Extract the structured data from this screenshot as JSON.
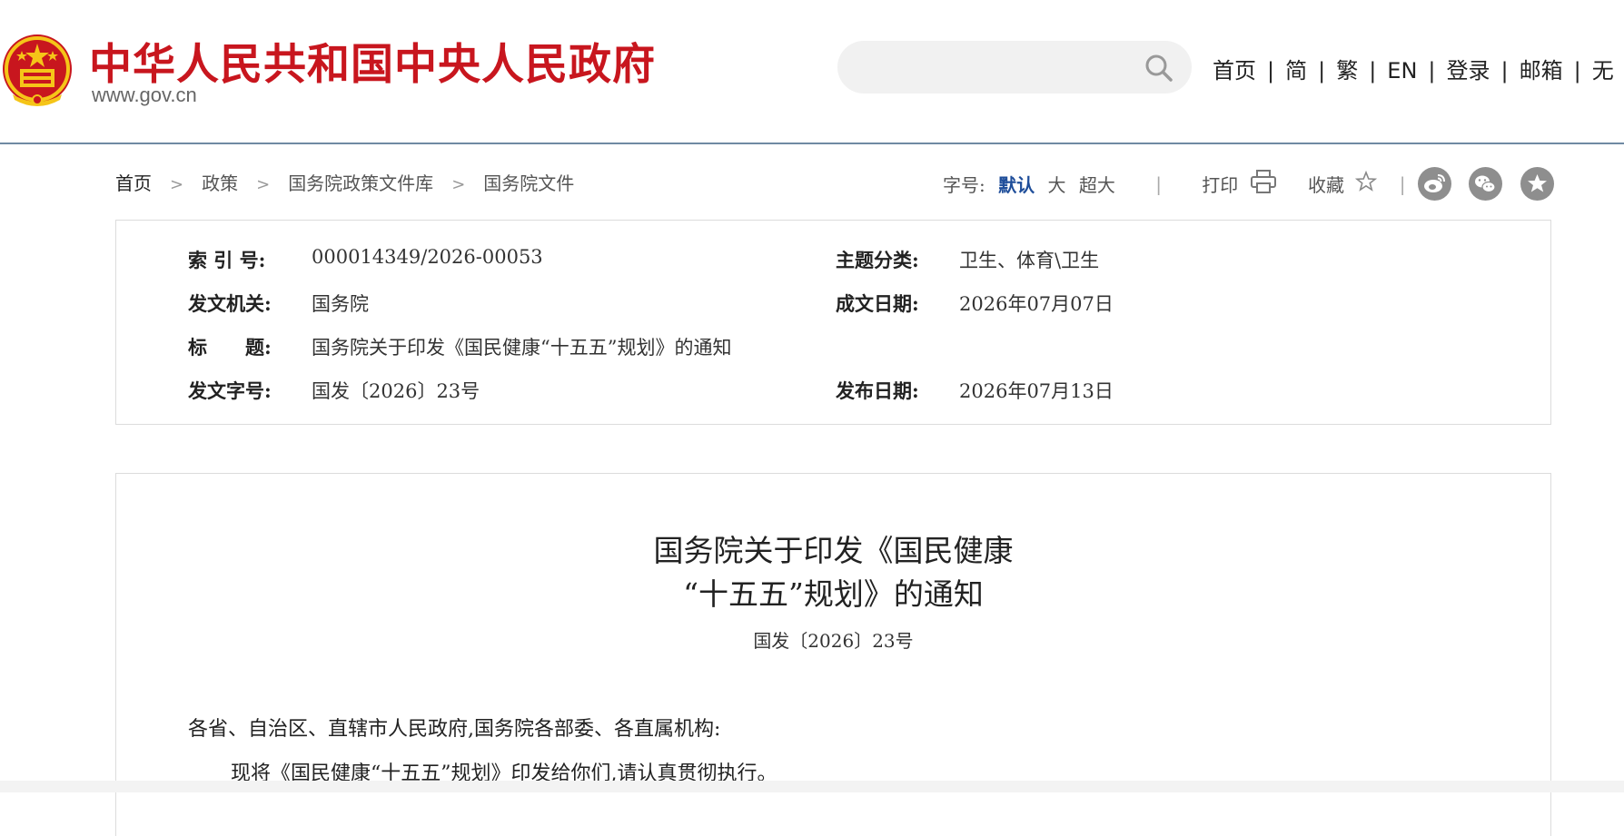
{
  "header": {
    "site_title": "中华人民共和国中央人民政府",
    "site_domain_main": "www.gov",
    "site_domain_suffix": ".cn",
    "search": {
      "placeholder": ""
    },
    "nav": [
      "首页",
      "简",
      "繁",
      "EN",
      "登录",
      "邮箱",
      "无"
    ]
  },
  "breadcrumb": [
    "首页",
    "政策",
    "国务院政策文件库",
    "国务院文件"
  ],
  "tools": {
    "font_size_label": "字号:",
    "font_sizes": [
      "默认",
      "大",
      "超大"
    ],
    "active_font_size": "默认",
    "print_label": "打印",
    "favorite_label": "收藏",
    "share_icons": [
      "weibo-icon",
      "wechat-icon",
      "star-icon"
    ]
  },
  "info": {
    "index_label": "索 引 号:",
    "index_value": "000014349/2026-00053",
    "topic_label": "主题分类:",
    "topic_value": "卫生、体育\\卫生",
    "issuer_label": "发文机关:",
    "issuer_value": "国务院",
    "written_label": "成文日期:",
    "written_value": "2026年07月07日",
    "title_label": "标　　题:",
    "title_value": "国务院关于印发《国民健康“十五五”规划》的通知",
    "docno_label": "发文字号:",
    "docno_value": "国发〔2026〕23号",
    "published_label": "发布日期:",
    "published_value": "2026年07月13日"
  },
  "document": {
    "title_line1": "国务院关于印发《国民健康",
    "title_line2": "“十五五”规划》的通知",
    "doc_number": "国发〔2026〕23号",
    "addressee": "各省、自治区、直辖市人民政府,国务院各部委、各直属机构:",
    "paragraph1": "现将《国民健康“十五五”规划》印发给你们,请认真贯彻执行。"
  },
  "colors": {
    "brand_red": "#c8161e",
    "emblem_gold": "#f5c518",
    "active_blue": "#1f4e9a",
    "header_rule": "#6f8aa3"
  }
}
